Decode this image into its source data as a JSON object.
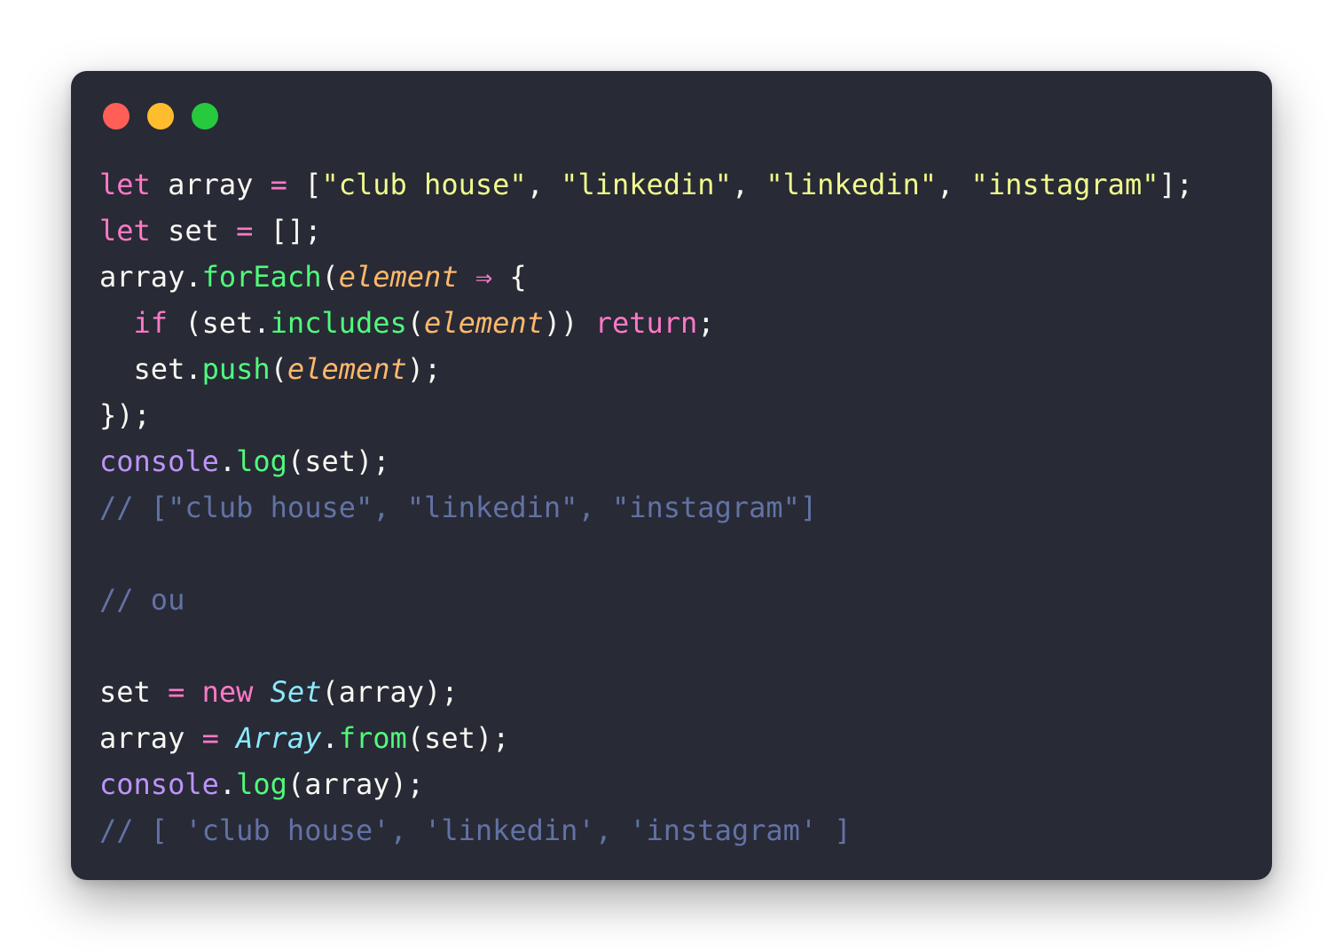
{
  "window": {
    "buttons": [
      {
        "name": "close",
        "color": "#ff5f56"
      },
      {
        "name": "minimize",
        "color": "#ffbd2e"
      },
      {
        "name": "maximize",
        "color": "#27c93f"
      }
    ]
  },
  "theme": {
    "background": "#282a36",
    "keyword": "#ff79c6",
    "string": "#f1fa8c",
    "function": "#50fa7b",
    "parameter": "#ffb86c",
    "class": "#8be9fd",
    "console": "#bd93f9",
    "comment": "#6272a4",
    "text": "#f8f8f2"
  },
  "code": {
    "lines": [
      [
        {
          "t": "keyword",
          "v": "let"
        },
        {
          "t": "plain",
          "v": " array "
        },
        {
          "t": "operator",
          "v": "="
        },
        {
          "t": "plain",
          "v": " ["
        },
        {
          "t": "string",
          "v": "\"club house\""
        },
        {
          "t": "plain",
          "v": ", "
        },
        {
          "t": "string",
          "v": "\"linkedin\""
        },
        {
          "t": "plain",
          "v": ", "
        },
        {
          "t": "string",
          "v": "\"linkedin\""
        },
        {
          "t": "plain",
          "v": ", "
        },
        {
          "t": "string",
          "v": "\"instagram\""
        },
        {
          "t": "plain",
          "v": "];"
        }
      ],
      [
        {
          "t": "keyword",
          "v": "let"
        },
        {
          "t": "plain",
          "v": " set "
        },
        {
          "t": "operator",
          "v": "="
        },
        {
          "t": "plain",
          "v": " [];"
        }
      ],
      [
        {
          "t": "plain",
          "v": "array."
        },
        {
          "t": "func",
          "v": "forEach"
        },
        {
          "t": "plain",
          "v": "("
        },
        {
          "t": "param",
          "v": "element"
        },
        {
          "t": "plain",
          "v": " "
        },
        {
          "t": "operator",
          "v": "⇒"
        },
        {
          "t": "plain",
          "v": " {"
        }
      ],
      [
        {
          "t": "plain",
          "v": "  "
        },
        {
          "t": "keyword",
          "v": "if"
        },
        {
          "t": "plain",
          "v": " (set."
        },
        {
          "t": "func",
          "v": "includes"
        },
        {
          "t": "plain",
          "v": "("
        },
        {
          "t": "param",
          "v": "element"
        },
        {
          "t": "plain",
          "v": ")) "
        },
        {
          "t": "keyword",
          "v": "return"
        },
        {
          "t": "plain",
          "v": ";"
        }
      ],
      [
        {
          "t": "plain",
          "v": "  set."
        },
        {
          "t": "func",
          "v": "push"
        },
        {
          "t": "plain",
          "v": "("
        },
        {
          "t": "param",
          "v": "element"
        },
        {
          "t": "plain",
          "v": ");"
        }
      ],
      [
        {
          "t": "plain",
          "v": "});"
        }
      ],
      [
        {
          "t": "console",
          "v": "console"
        },
        {
          "t": "plain",
          "v": "."
        },
        {
          "t": "func",
          "v": "log"
        },
        {
          "t": "plain",
          "v": "(set);"
        }
      ],
      [
        {
          "t": "comment",
          "v": "// [\"club house\", \"linkedin\", \"instagram\"]"
        }
      ],
      [],
      [
        {
          "t": "comment",
          "v": "// ou"
        }
      ],
      [],
      [
        {
          "t": "plain",
          "v": "set "
        },
        {
          "t": "operator",
          "v": "="
        },
        {
          "t": "plain",
          "v": " "
        },
        {
          "t": "keyword",
          "v": "new"
        },
        {
          "t": "plain",
          "v": " "
        },
        {
          "t": "class",
          "v": "Set"
        },
        {
          "t": "plain",
          "v": "(array);"
        }
      ],
      [
        {
          "t": "plain",
          "v": "array "
        },
        {
          "t": "operator",
          "v": "="
        },
        {
          "t": "plain",
          "v": " "
        },
        {
          "t": "class",
          "v": "Array"
        },
        {
          "t": "plain",
          "v": "."
        },
        {
          "t": "func",
          "v": "from"
        },
        {
          "t": "plain",
          "v": "(set);"
        }
      ],
      [
        {
          "t": "console",
          "v": "console"
        },
        {
          "t": "plain",
          "v": "."
        },
        {
          "t": "func",
          "v": "log"
        },
        {
          "t": "plain",
          "v": "(array);"
        }
      ],
      [
        {
          "t": "comment",
          "v": "// [ 'club house', 'linkedin', 'instagram' ]"
        }
      ]
    ]
  }
}
